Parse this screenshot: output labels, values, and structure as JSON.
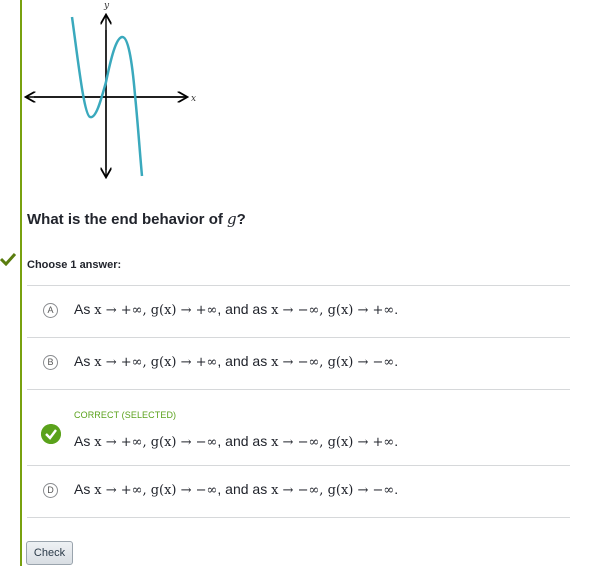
{
  "graph": {
    "y_label": "y",
    "x_label": "x"
  },
  "question": {
    "prefix": "What is the end behavior of ",
    "var": "g",
    "suffix": "?"
  },
  "choose_label": "Choose 1 answer:",
  "choices": [
    {
      "letter": "A",
      "status": "",
      "text_prefix": "As ",
      "math1": "x → +∞, g(x) → +∞",
      "middle": ", and as ",
      "math2": "x → −∞, g(x) → +∞",
      "end": "."
    },
    {
      "letter": "B",
      "status": "",
      "text_prefix": "As ",
      "math1": "x → +∞, g(x) → +∞",
      "middle": ", and as ",
      "math2": "x → −∞, g(x) → −∞",
      "end": "."
    },
    {
      "letter": "C",
      "status": "CORRECT (SELECTED)",
      "text_prefix": "As ",
      "math1": "x → +∞, g(x) → −∞",
      "middle": ", and as ",
      "math2": "x → −∞, g(x) → +∞",
      "end": "."
    },
    {
      "letter": "D",
      "status": "",
      "text_prefix": "As ",
      "math1": "x → +∞, g(x) → −∞",
      "middle": ", and as ",
      "math2": "x → −∞, g(x) → −∞",
      "end": "."
    }
  ],
  "check_button": "Check",
  "colors": {
    "accent_green": "#5aa21b",
    "rule_green": "#78a10f",
    "curve": "#3aa9bd"
  }
}
